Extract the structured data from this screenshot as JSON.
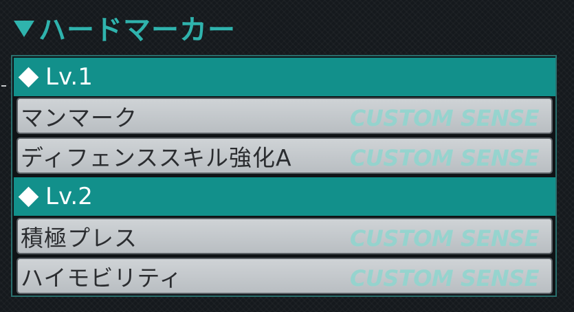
{
  "section": {
    "title": "ハードマーカー",
    "title_icon": "triangle-down-icon"
  },
  "levels": [
    {
      "label": "Lv.1",
      "icon": "diamond-icon",
      "skills": [
        {
          "name": "マンマーク",
          "tag": "CUSTOM SENSE"
        },
        {
          "name": "ディフェンススキル強化A",
          "tag": "CUSTOM SENSE"
        }
      ]
    },
    {
      "label": "Lv.2",
      "icon": "diamond-icon",
      "skills": [
        {
          "name": "積極プレス",
          "tag": "CUSTOM SENSE"
        },
        {
          "name": "ハイモビリティ",
          "tag": "CUSTOM SENSE"
        }
      ]
    }
  ],
  "colors": {
    "accent": "#12908b",
    "title": "#2fb3ad",
    "row_bg": "#c4c8cb",
    "tag_text": "#8ed6cf",
    "background": "#15191d"
  }
}
